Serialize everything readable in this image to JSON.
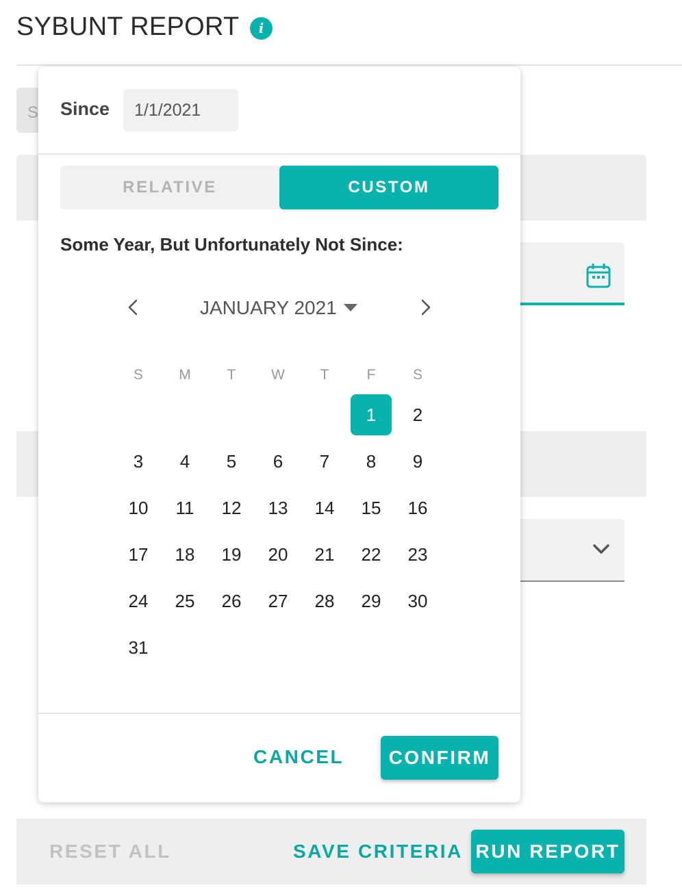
{
  "header": {
    "title": "SYBUNT REPORT",
    "info_icon": "info-icon"
  },
  "background": {
    "partial_tab_text": "S",
    "date_field_icon": "calendar-icon",
    "select_field_icon": "chevron-down-icon"
  },
  "footer": {
    "reset_label": "RESET ALL",
    "save_label": "SAVE CRITERIA",
    "run_label": "RUN REPORT"
  },
  "popover": {
    "since_label": "Since",
    "since_value": "1/1/2021",
    "toggle": {
      "options": [
        "RELATIVE",
        "CUSTOM"
      ],
      "selected": "CUSTOM"
    },
    "prompt": "Some Year, But Unfortunately Not Since:",
    "calendar": {
      "month_label": "JANUARY 2021",
      "weekdays": [
        "S",
        "M",
        "T",
        "W",
        "T",
        "F",
        "S"
      ],
      "weeks": [
        [
          "",
          "",
          "",
          "",
          "",
          "1",
          "2"
        ],
        [
          "3",
          "4",
          "5",
          "6",
          "7",
          "8",
          "9"
        ],
        [
          "10",
          "11",
          "12",
          "13",
          "14",
          "15",
          "16"
        ],
        [
          "17",
          "18",
          "19",
          "20",
          "21",
          "22",
          "23"
        ],
        [
          "24",
          "25",
          "26",
          "27",
          "28",
          "29",
          "30"
        ],
        [
          "31",
          "",
          "",
          "",
          "",
          "",
          ""
        ]
      ],
      "selected_day": "1"
    },
    "cancel_label": "CANCEL",
    "confirm_label": "CONFIRM"
  },
  "colors": {
    "accent": "#09b3ad",
    "accent_text": "#09a8a2",
    "muted": "#b3b3b3"
  }
}
